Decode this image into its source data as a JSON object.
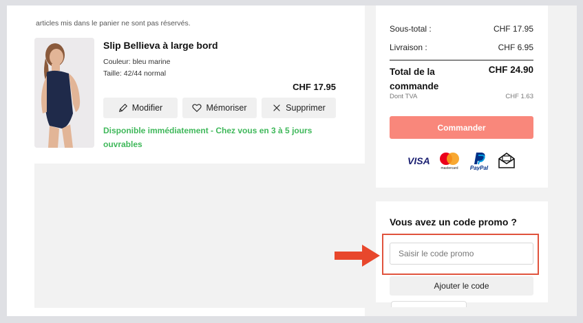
{
  "cart": {
    "notice": "articles mis dans le panier ne sont pas réservés.",
    "item": {
      "title": "Slip Bellieva à large bord",
      "color": "Couleur: bleu marine",
      "size": "Taille: 42/44 normal",
      "price": "CHF 17.95",
      "image_icon": "product-photo-model",
      "actions": {
        "modify": "Modifier",
        "save": "Mémoriser",
        "delete": "Supprimer"
      },
      "availability": "Disponible immédiatement - Chez vous en 3 à 5 jours ouvrables"
    }
  },
  "summary": {
    "subtotal_label": "Sous-total :",
    "subtotal_value": "CHF 17.95",
    "shipping_label": "Livraison :",
    "shipping_value": "CHF 6.95",
    "total_label": "Total de la commande",
    "total_value": "CHF 24.90",
    "tva_label": "Dont TVA",
    "tva_value": "CHF 1.63",
    "order_button": "Commander",
    "payment_methods": [
      "VISA",
      "mastercard",
      "PayPal",
      "invoice-envelope"
    ]
  },
  "promo": {
    "title": "Vous avez un code promo ?",
    "placeholder": "Saisir le code promo",
    "value": "",
    "add_button": "Ajouter le code"
  },
  "colors": {
    "accent": "#f9877b",
    "availability_green": "#3fb85a",
    "highlight_red": "#e0523c"
  }
}
